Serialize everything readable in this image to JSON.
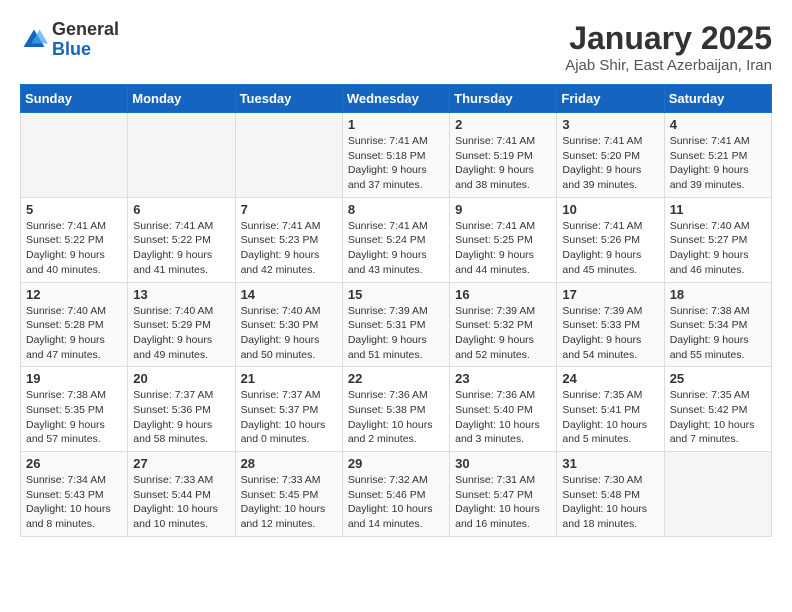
{
  "logo": {
    "general": "General",
    "blue": "Blue"
  },
  "header": {
    "title": "January 2025",
    "subtitle": "Ajab Shir, East Azerbaijan, Iran"
  },
  "weekdays": [
    "Sunday",
    "Monday",
    "Tuesday",
    "Wednesday",
    "Thursday",
    "Friday",
    "Saturday"
  ],
  "weeks": [
    [
      {
        "day": "",
        "info": ""
      },
      {
        "day": "",
        "info": ""
      },
      {
        "day": "",
        "info": ""
      },
      {
        "day": "1",
        "info": "Sunrise: 7:41 AM\nSunset: 5:18 PM\nDaylight: 9 hours and 37 minutes."
      },
      {
        "day": "2",
        "info": "Sunrise: 7:41 AM\nSunset: 5:19 PM\nDaylight: 9 hours and 38 minutes."
      },
      {
        "day": "3",
        "info": "Sunrise: 7:41 AM\nSunset: 5:20 PM\nDaylight: 9 hours and 39 minutes."
      },
      {
        "day": "4",
        "info": "Sunrise: 7:41 AM\nSunset: 5:21 PM\nDaylight: 9 hours and 39 minutes."
      }
    ],
    [
      {
        "day": "5",
        "info": "Sunrise: 7:41 AM\nSunset: 5:22 PM\nDaylight: 9 hours and 40 minutes."
      },
      {
        "day": "6",
        "info": "Sunrise: 7:41 AM\nSunset: 5:22 PM\nDaylight: 9 hours and 41 minutes."
      },
      {
        "day": "7",
        "info": "Sunrise: 7:41 AM\nSunset: 5:23 PM\nDaylight: 9 hours and 42 minutes."
      },
      {
        "day": "8",
        "info": "Sunrise: 7:41 AM\nSunset: 5:24 PM\nDaylight: 9 hours and 43 minutes."
      },
      {
        "day": "9",
        "info": "Sunrise: 7:41 AM\nSunset: 5:25 PM\nDaylight: 9 hours and 44 minutes."
      },
      {
        "day": "10",
        "info": "Sunrise: 7:41 AM\nSunset: 5:26 PM\nDaylight: 9 hours and 45 minutes."
      },
      {
        "day": "11",
        "info": "Sunrise: 7:40 AM\nSunset: 5:27 PM\nDaylight: 9 hours and 46 minutes."
      }
    ],
    [
      {
        "day": "12",
        "info": "Sunrise: 7:40 AM\nSunset: 5:28 PM\nDaylight: 9 hours and 47 minutes."
      },
      {
        "day": "13",
        "info": "Sunrise: 7:40 AM\nSunset: 5:29 PM\nDaylight: 9 hours and 49 minutes."
      },
      {
        "day": "14",
        "info": "Sunrise: 7:40 AM\nSunset: 5:30 PM\nDaylight: 9 hours and 50 minutes."
      },
      {
        "day": "15",
        "info": "Sunrise: 7:39 AM\nSunset: 5:31 PM\nDaylight: 9 hours and 51 minutes."
      },
      {
        "day": "16",
        "info": "Sunrise: 7:39 AM\nSunset: 5:32 PM\nDaylight: 9 hours and 52 minutes."
      },
      {
        "day": "17",
        "info": "Sunrise: 7:39 AM\nSunset: 5:33 PM\nDaylight: 9 hours and 54 minutes."
      },
      {
        "day": "18",
        "info": "Sunrise: 7:38 AM\nSunset: 5:34 PM\nDaylight: 9 hours and 55 minutes."
      }
    ],
    [
      {
        "day": "19",
        "info": "Sunrise: 7:38 AM\nSunset: 5:35 PM\nDaylight: 9 hours and 57 minutes."
      },
      {
        "day": "20",
        "info": "Sunrise: 7:37 AM\nSunset: 5:36 PM\nDaylight: 9 hours and 58 minutes."
      },
      {
        "day": "21",
        "info": "Sunrise: 7:37 AM\nSunset: 5:37 PM\nDaylight: 10 hours and 0 minutes."
      },
      {
        "day": "22",
        "info": "Sunrise: 7:36 AM\nSunset: 5:38 PM\nDaylight: 10 hours and 2 minutes."
      },
      {
        "day": "23",
        "info": "Sunrise: 7:36 AM\nSunset: 5:40 PM\nDaylight: 10 hours and 3 minutes."
      },
      {
        "day": "24",
        "info": "Sunrise: 7:35 AM\nSunset: 5:41 PM\nDaylight: 10 hours and 5 minutes."
      },
      {
        "day": "25",
        "info": "Sunrise: 7:35 AM\nSunset: 5:42 PM\nDaylight: 10 hours and 7 minutes."
      }
    ],
    [
      {
        "day": "26",
        "info": "Sunrise: 7:34 AM\nSunset: 5:43 PM\nDaylight: 10 hours and 8 minutes."
      },
      {
        "day": "27",
        "info": "Sunrise: 7:33 AM\nSunset: 5:44 PM\nDaylight: 10 hours and 10 minutes."
      },
      {
        "day": "28",
        "info": "Sunrise: 7:33 AM\nSunset: 5:45 PM\nDaylight: 10 hours and 12 minutes."
      },
      {
        "day": "29",
        "info": "Sunrise: 7:32 AM\nSunset: 5:46 PM\nDaylight: 10 hours and 14 minutes."
      },
      {
        "day": "30",
        "info": "Sunrise: 7:31 AM\nSunset: 5:47 PM\nDaylight: 10 hours and 16 minutes."
      },
      {
        "day": "31",
        "info": "Sunrise: 7:30 AM\nSunset: 5:48 PM\nDaylight: 10 hours and 18 minutes."
      },
      {
        "day": "",
        "info": ""
      }
    ]
  ]
}
